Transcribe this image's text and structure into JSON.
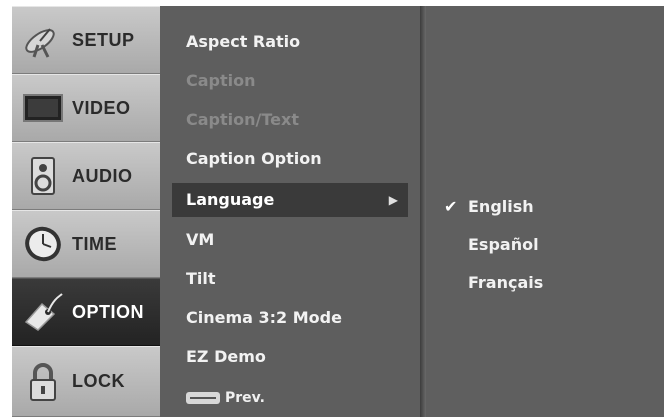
{
  "tabs": [
    {
      "label": "SETUP",
      "icon": "satellite-dish-icon"
    },
    {
      "label": "VIDEO",
      "icon": "tv-screen-icon"
    },
    {
      "label": "AUDIO",
      "icon": "speaker-icon"
    },
    {
      "label": "TIME",
      "icon": "clock-icon"
    },
    {
      "label": "OPTION",
      "icon": "tag-icon"
    },
    {
      "label": "LOCK",
      "icon": "padlock-icon"
    }
  ],
  "active_tab": "OPTION",
  "menu": {
    "items": [
      {
        "label": "Aspect Ratio",
        "enabled": true
      },
      {
        "label": "Caption",
        "enabled": false
      },
      {
        "label": "Caption/Text",
        "enabled": false
      },
      {
        "label": "Caption Option",
        "enabled": true
      },
      {
        "label": "Language",
        "enabled": true,
        "selected": true
      },
      {
        "label": "VM",
        "enabled": true
      },
      {
        "label": "Tilt",
        "enabled": true
      },
      {
        "label": "Cinema 3:2 Mode",
        "enabled": true
      },
      {
        "label": "EZ Demo",
        "enabled": true
      }
    ],
    "prev_label": "Prev."
  },
  "submenu": {
    "check_glyph": "✔",
    "options": [
      "English",
      "Español",
      "Français"
    ],
    "checked": "English"
  },
  "colors": {
    "panel": "#5f5f5f",
    "tab_inactive": "#b9b9b9",
    "tab_active": "#2a2a2a",
    "highlight": "#3a3a3a",
    "text": "#f2f2f2",
    "text_dim": "#8a8a8a"
  }
}
